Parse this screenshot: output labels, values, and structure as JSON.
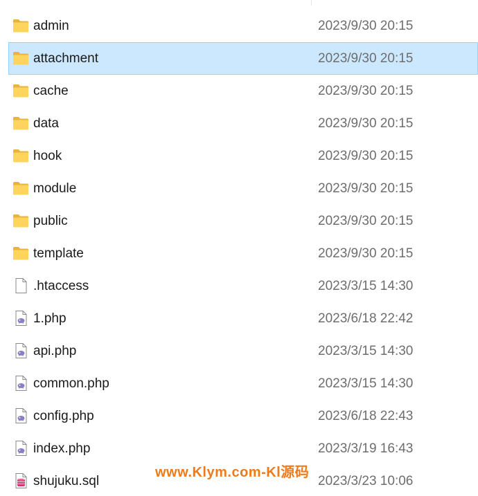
{
  "files": [
    {
      "name": "admin",
      "modified": "2023/9/30 20:15",
      "icon": "folder-icon"
    },
    {
      "name": "attachment",
      "modified": "2023/9/30 20:15",
      "icon": "folder-icon",
      "selected": true
    },
    {
      "name": "cache",
      "modified": "2023/9/30 20:15",
      "icon": "folder-icon"
    },
    {
      "name": "data",
      "modified": "2023/9/30 20:15",
      "icon": "folder-icon"
    },
    {
      "name": "hook",
      "modified": "2023/9/30 20:15",
      "icon": "folder-icon"
    },
    {
      "name": "module",
      "modified": "2023/9/30 20:15",
      "icon": "folder-icon"
    },
    {
      "name": "public",
      "modified": "2023/9/30 20:15",
      "icon": "folder-icon"
    },
    {
      "name": "template",
      "modified": "2023/9/30 20:15",
      "icon": "folder-icon"
    },
    {
      "name": ".htaccess",
      "modified": "2023/3/15 14:30",
      "icon": "blank-file-icon"
    },
    {
      "name": "1.php",
      "modified": "2023/6/18 22:42",
      "icon": "php-file-icon"
    },
    {
      "name": "api.php",
      "modified": "2023/3/15 14:30",
      "icon": "php-file-icon"
    },
    {
      "name": "common.php",
      "modified": "2023/3/15 14:30",
      "icon": "php-file-icon"
    },
    {
      "name": "config.php",
      "modified": "2023/6/18 22:43",
      "icon": "php-file-icon"
    },
    {
      "name": "index.php",
      "modified": "2023/3/19 16:43",
      "icon": "php-file-icon"
    },
    {
      "name": "shujuku.sql",
      "modified": "2023/3/23 10:06",
      "icon": "sql-file-icon"
    }
  ],
  "watermark": "www.Klym.com-Kl源码",
  "colors": {
    "selection_bg": "#cce8ff",
    "selection_border": "#99d1ff",
    "date_text": "#6d6d6d",
    "watermark": "#f07a1a"
  }
}
